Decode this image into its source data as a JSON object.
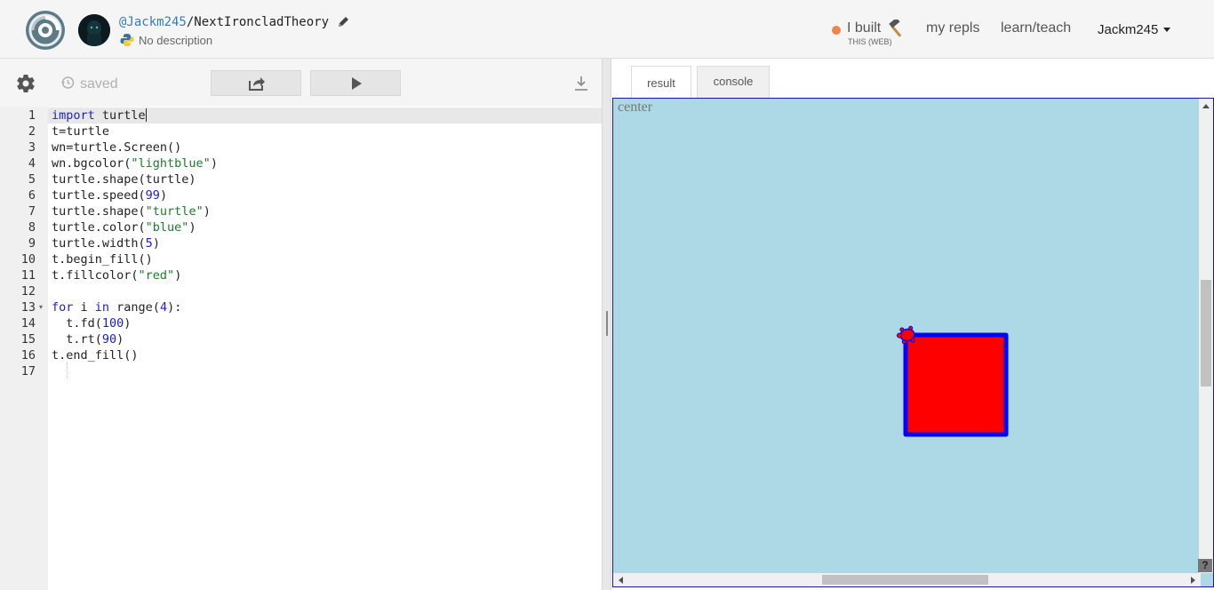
{
  "header": {
    "username": "@Jackm245",
    "repl_name": "NextIroncladTheory",
    "separator": "/",
    "description": "No description",
    "ibuilt_label": "I built",
    "ibuilt_sub": "THIS (WEB)",
    "nav": {
      "my_repls": "my repls",
      "learn_teach": "learn/teach"
    },
    "account": "Jackm245",
    "icons": [
      "repl-logo-icon",
      "avatar",
      "pencil-icon",
      "python-icon",
      "hammer-icon",
      "caret-down-icon"
    ],
    "colors": {
      "ibuilt_dot": "#f0834a",
      "user_link": "#3a7bb8"
    }
  },
  "editor": {
    "saved_label": "saved",
    "icons": [
      "gear-icon",
      "history-icon",
      "share-icon",
      "run-icon",
      "download-icon"
    ],
    "line_numbers": [
      "1",
      "2",
      "3",
      "4",
      "5",
      "6",
      "7",
      "8",
      "9",
      "10",
      "11",
      "12",
      "13",
      "14",
      "15",
      "16",
      "17"
    ],
    "fold_marker": "▾"
  },
  "output": {
    "tabs": {
      "result": "result",
      "console": "console"
    },
    "canvas_label": "center",
    "help": "?",
    "canvas_bg": "#add8e6",
    "square_fill": "#ff0000",
    "square_stroke": "#0000ff"
  }
}
